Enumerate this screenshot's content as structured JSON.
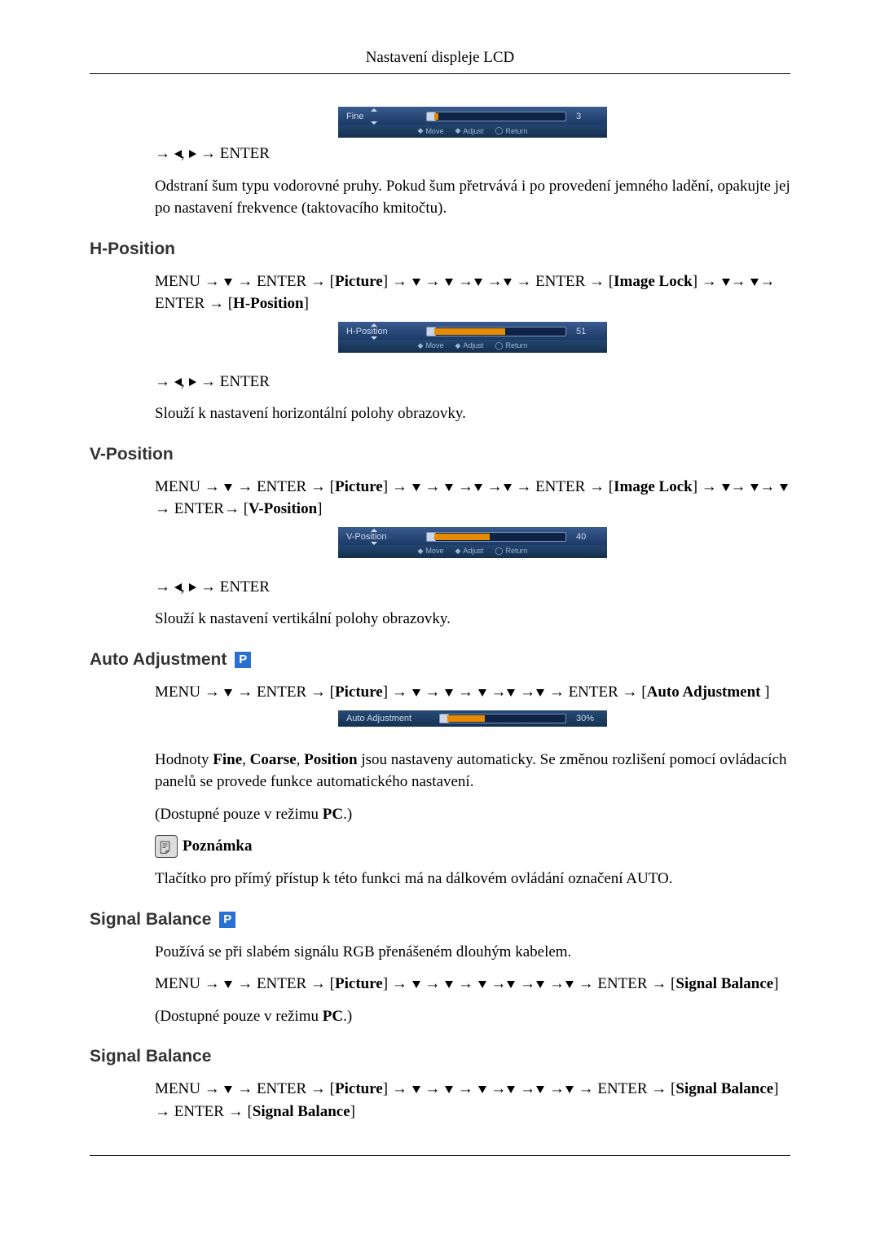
{
  "header": {
    "title": "Nastavení displeje LCD"
  },
  "osd": {
    "fine": {
      "label": "Fine",
      "value": "3",
      "fill_pct": 3
    },
    "hpos": {
      "label": "H-Position",
      "value": "51",
      "fill_pct": 51
    },
    "vpos": {
      "label": "V-Position",
      "value": "40",
      "fill_pct": 40
    },
    "auto": {
      "label": "Auto Adjustment",
      "value": "30%",
      "fill_pct": 30
    },
    "hints": {
      "move": "Move",
      "adjust": "Adjust",
      "return": "Return"
    }
  },
  "terms": {
    "menu": "MENU",
    "enter": "ENTER",
    "picture": "Picture",
    "image_lock": "Image Lock",
    "hpos": "H-Position",
    "vpos": "V-Position",
    "auto": "Auto Adjustment",
    "signal_balance": "Signal Balance",
    "fine": "Fine",
    "coarse": "Coarse",
    "position": "Position",
    "pc": "PC",
    "note": "Poznámka"
  },
  "sections": {
    "fine": {
      "enter_arrows": "→ ◀, ▶ → ENTER",
      "desc": "Odstraní šum typu vodorovné pruhy. Pokud šum přetrvává i po provedení jemného ladění, opakujte jej po nastavení frekvence (taktovacího kmitočtu)."
    },
    "hpos": {
      "title": "H-Position",
      "desc": "Slouží k nastavení horizontální polohy obrazovky."
    },
    "vpos": {
      "title": "V-Position",
      "desc": "Slouží k nastavení vertikální polohy obrazovky."
    },
    "auto": {
      "title": "Auto Adjustment",
      "desc_pre": "Hodnoty ",
      "desc_mid": " jsou nastaveny automaticky. Se změnou rozlišení pomocí ovládacích panelů se provede funkce automatického nastavení.",
      "avail_pre": "(Dostupné pouze v režimu ",
      "avail_post": ".)",
      "note_body": "Tlačítko pro přímý přístup k této funkci má na dálkovém ovládání označení AUTO."
    },
    "sig1": {
      "title": "Signal Balance",
      "desc": "Používá se při slabém signálu RGB přenášeném dlouhým kabelem.",
      "avail_pre": "(Dostupné pouze v režimu ",
      "avail_post": ".)"
    },
    "sig2": {
      "title": "Signal Balance"
    }
  }
}
